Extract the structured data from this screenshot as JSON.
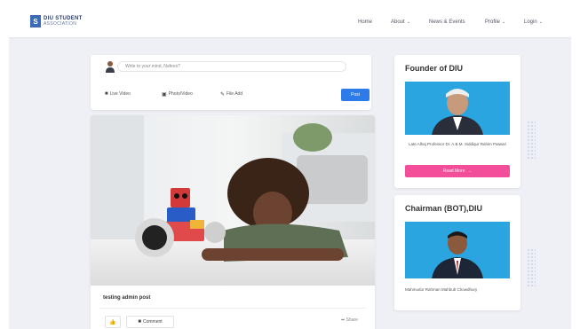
{
  "brand": {
    "logo_letter": "S",
    "name": "DIU STUDENT",
    "tagline": "ASSOCIATION"
  },
  "nav": {
    "items": [
      {
        "label": "Home",
        "caret": ""
      },
      {
        "label": "About",
        "caret": "⌄"
      },
      {
        "label": "News & Events",
        "caret": ""
      },
      {
        "label": "Profile",
        "caret": "⌄"
      },
      {
        "label": "Login",
        "caret": "⌄"
      }
    ]
  },
  "composer": {
    "placeholder": "Write to your mind, Nafees?",
    "actions": [
      {
        "label": "Live Video",
        "icon": "video-icon"
      },
      {
        "label": "Photo/Video",
        "icon": "photo-icon"
      },
      {
        "label": "File Add",
        "icon": "attach-icon"
      }
    ],
    "post_label": "Post"
  },
  "post": {
    "title": "testing admin post",
    "like_icon": "👍",
    "comment_label": "Comment",
    "share_label": "Share"
  },
  "founder": {
    "title": "Founder of DIU",
    "caption": "Late Alhaj Professor Dr. A.B.M. Siddiqur Rahim Patwari",
    "button_label": "Read More"
  },
  "chairman": {
    "title": "Chairman (BOT),DIU",
    "caption": "Mahmudur Rahman Mahbub Chowdhury"
  },
  "colors": {
    "accent": "#2d7be8",
    "pink": "#f24e9a",
    "photo_bg": "#2aa5e0"
  }
}
